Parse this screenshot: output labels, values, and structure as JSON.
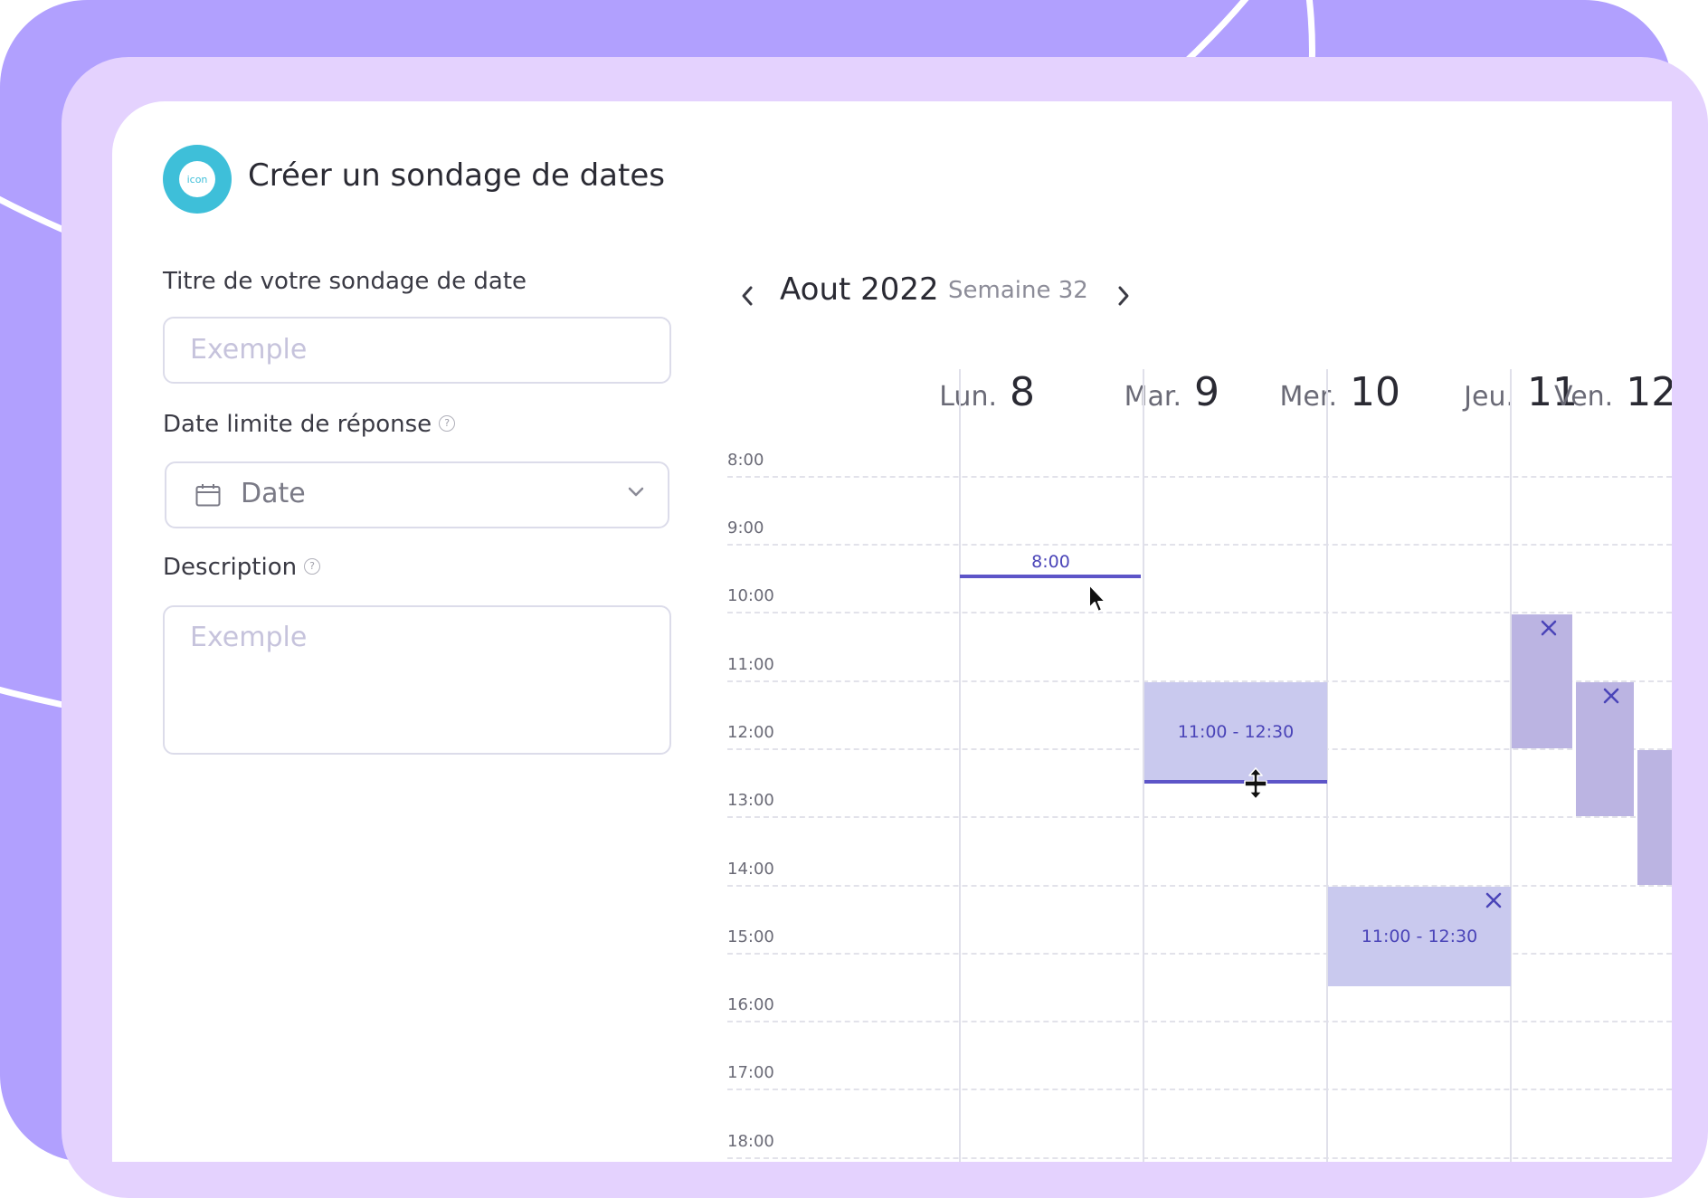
{
  "app": {
    "title": "Créer un sondage de dates",
    "icon_text": "icon"
  },
  "form": {
    "title_label": "Titre de votre sondage de date",
    "title_placeholder": "Exemple",
    "deadline_label": "Date limite de réponse",
    "deadline_value": "Date",
    "description_label": "Description",
    "description_placeholder": "Exemple",
    "help_glyph": "?"
  },
  "calendar": {
    "month": "Aout 2022",
    "week": "Semaine 32",
    "days": [
      {
        "name": "Lun.",
        "num": "8"
      },
      {
        "name": "Mar.",
        "num": "9"
      },
      {
        "name": "Mer.",
        "num": "10"
      },
      {
        "name": "Jeu.",
        "num": "11"
      },
      {
        "name": "Ven.",
        "num": "12"
      }
    ],
    "hours": [
      "8:00",
      "9:00",
      "10:00",
      "11:00",
      "12:00",
      "13:00",
      "14:00",
      "15:00",
      "16:00",
      "17:00",
      "18:00"
    ],
    "drag_indicator": "8:00",
    "events": [
      {
        "label": "11:00 - 12:30"
      },
      {
        "label": "11:00 - 12:30"
      }
    ]
  },
  "colors": {
    "accent": "#5d55c8",
    "event_fill": "#c9c9ee",
    "event_fill_dark": "#bbb4e2",
    "brand_icon": "#3ebfd9",
    "background_outer": "#b1a0fe",
    "background_inner": "#e4d2fe"
  },
  "icons": {
    "header": "app-icon",
    "calendar": "calendar-icon",
    "dropdown": "chevron-down-icon",
    "prev": "chevron-left-icon",
    "next": "chevron-right-icon",
    "remove": "close-icon",
    "help": "help-icon",
    "cursor": "mouse-pointer-icon",
    "resize": "resize-vertical-cursor-icon"
  }
}
